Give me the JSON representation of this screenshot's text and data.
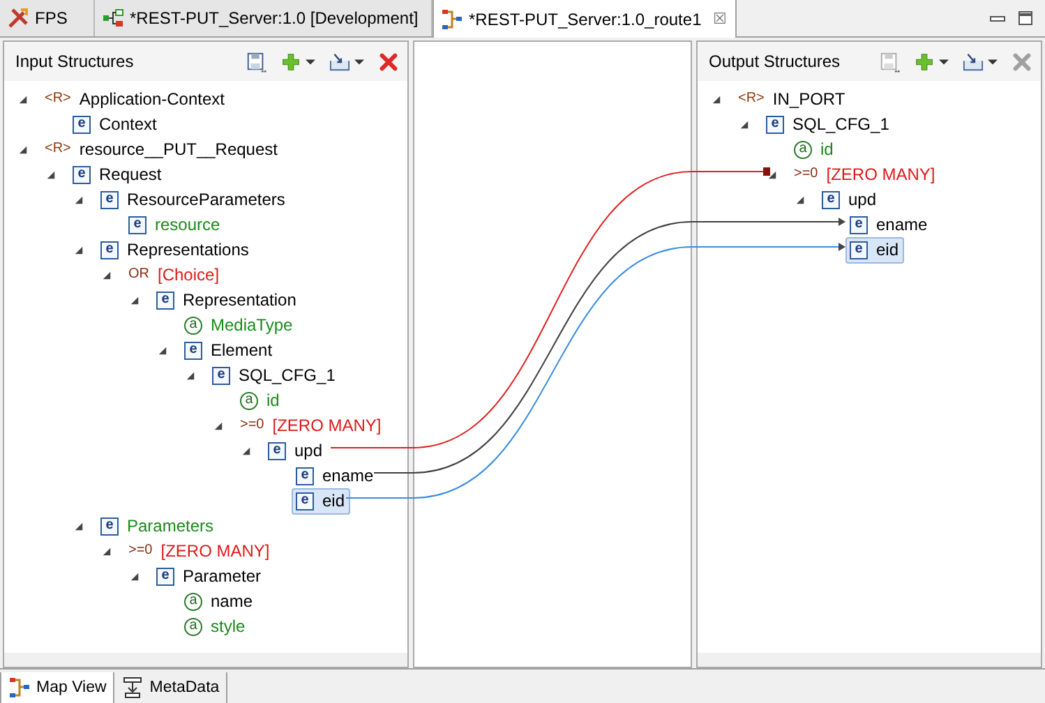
{
  "editor_tabs": [
    {
      "kind": "tool",
      "label": "FPS",
      "selected": false
    },
    {
      "kind": "flow",
      "label": "*REST-PUT_Server:1.0 [Development]",
      "selected": false
    },
    {
      "kind": "route",
      "label": "*REST-PUT_Server:1.0_route1",
      "selected": true,
      "close": "☒"
    }
  ],
  "input": {
    "title": "Input Structures",
    "toolbar": [
      {
        "kind": "save",
        "disabled": false
      },
      {
        "kind": "add",
        "disabled": false
      },
      {
        "kind": "import",
        "disabled": false
      },
      {
        "kind": "delete",
        "disabled": false
      }
    ],
    "tree": [
      {
        "kind": "root",
        "badge": "<R>",
        "label": "Application-Context",
        "expanded": true,
        "optional": false,
        "selected": false,
        "children": [
          {
            "kind": "element",
            "badge": "e",
            "label": "Context",
            "optional": false,
            "selected": false
          }
        ]
      },
      {
        "kind": "root",
        "badge": "<R>",
        "label": "resource__PUT__Request",
        "expanded": true,
        "optional": false,
        "selected": false,
        "children": [
          {
            "kind": "element",
            "badge": "e",
            "label": "Request",
            "expanded": true,
            "optional": false,
            "selected": false,
            "children": [
              {
                "kind": "element",
                "badge": "e",
                "label": "ResourceParameters",
                "expanded": true,
                "optional": false,
                "selected": false,
                "children": [
                  {
                    "kind": "element",
                    "badge": "e",
                    "label": "resource",
                    "optional": true,
                    "selected": false
                  }
                ]
              },
              {
                "kind": "element",
                "badge": "e",
                "label": "Representations",
                "expanded": true,
                "optional": false,
                "selected": false,
                "children": [
                  {
                    "kind": "choice",
                    "badge": "OR",
                    "label": "[Choice]",
                    "expanded": true,
                    "optional": false,
                    "selected": false,
                    "children": [
                      {
                        "kind": "element",
                        "badge": "e",
                        "label": "Representation",
                        "expanded": true,
                        "optional": false,
                        "selected": false,
                        "children": [
                          {
                            "kind": "attribute",
                            "badge": "a",
                            "label": "MediaType",
                            "optional": true,
                            "selected": false
                          },
                          {
                            "kind": "element",
                            "badge": "e",
                            "label": "Element",
                            "expanded": true,
                            "optional": false,
                            "selected": false,
                            "children": [
                              {
                                "kind": "element",
                                "badge": "e",
                                "label": "SQL_CFG_1",
                                "expanded": true,
                                "optional": false,
                                "selected": false,
                                "children": [
                                  {
                                    "kind": "attribute",
                                    "badge": "a",
                                    "label": "id",
                                    "optional": true,
                                    "selected": false
                                  },
                                  {
                                    "kind": "multi",
                                    "badge": ">=0",
                                    "label": "[ZERO MANY]",
                                    "expanded": true,
                                    "optional": false,
                                    "selected": false,
                                    "children": [
                                      {
                                        "kind": "element",
                                        "badge": "e",
                                        "label": "upd",
                                        "expanded": true,
                                        "optional": false,
                                        "selected": false,
                                        "children": [
                                          {
                                            "kind": "element",
                                            "badge": "e",
                                            "label": "ename",
                                            "optional": false,
                                            "selected": false
                                          },
                                          {
                                            "kind": "element",
                                            "badge": "e",
                                            "label": "eid",
                                            "optional": false,
                                            "selected": true
                                          }
                                        ]
                                      }
                                    ]
                                  }
                                ]
                              }
                            ]
                          }
                        ]
                      }
                    ]
                  }
                ]
              },
              {
                "kind": "element",
                "badge": "e",
                "label": "Parameters",
                "expanded": true,
                "optional": true,
                "selected": false,
                "children": [
                  {
                    "kind": "multi",
                    "badge": ">=0",
                    "label": "[ZERO MANY]",
                    "expanded": true,
                    "optional": false,
                    "selected": false,
                    "children": [
                      {
                        "kind": "element",
                        "badge": "e",
                        "label": "Parameter",
                        "expanded": true,
                        "optional": false,
                        "selected": false,
                        "children": [
                          {
                            "kind": "attribute",
                            "badge": "a",
                            "label": "name",
                            "optional": false,
                            "selected": false
                          },
                          {
                            "kind": "attribute",
                            "badge": "a",
                            "label": "style",
                            "optional": true,
                            "selected": false
                          }
                        ]
                      }
                    ]
                  }
                ]
              }
            ]
          }
        ]
      }
    ]
  },
  "output": {
    "title": "Output Structures",
    "toolbar": [
      {
        "kind": "save",
        "disabled": true
      },
      {
        "kind": "add",
        "disabled": false
      },
      {
        "kind": "import",
        "disabled": false
      },
      {
        "kind": "delete",
        "disabled": true
      }
    ],
    "tree": [
      {
        "kind": "root",
        "badge": "<R>",
        "label": "IN_PORT",
        "expanded": true,
        "optional": false,
        "selected": false,
        "children": [
          {
            "kind": "element",
            "badge": "e",
            "label": "SQL_CFG_1",
            "expanded": true,
            "optional": false,
            "selected": false,
            "children": [
              {
                "kind": "attribute",
                "badge": "a",
                "label": "id",
                "optional": true,
                "selected": false
              },
              {
                "kind": "multi",
                "badge": ">=0",
                "label": "[ZERO MANY]",
                "expanded": true,
                "optional": false,
                "selected": false,
                "children": [
                  {
                    "kind": "element",
                    "badge": "e",
                    "label": "upd",
                    "expanded": true,
                    "optional": false,
                    "selected": false,
                    "children": [
                      {
                        "kind": "element",
                        "badge": "e",
                        "label": "ename",
                        "optional": false,
                        "selected": false
                      },
                      {
                        "kind": "element",
                        "badge": "e",
                        "label": "eid",
                        "optional": false,
                        "selected": true
                      }
                    ]
                  }
                ]
              }
            ]
          }
        ]
      }
    ]
  },
  "mappings": [
    {
      "color": "#e02020"
    },
    {
      "color": "#404040"
    },
    {
      "color": "#3b8ee0"
    }
  ],
  "bottom_tabs": [
    {
      "kind": "map",
      "label": "Map View",
      "selected": true
    },
    {
      "kind": "meta",
      "label": "MetaData",
      "selected": false
    }
  ]
}
